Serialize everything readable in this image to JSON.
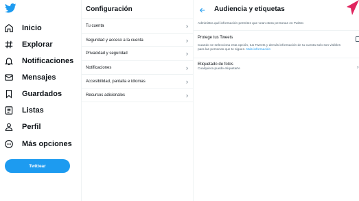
{
  "nav": {
    "items": [
      {
        "label": "Inicio",
        "icon": "home-icon"
      },
      {
        "label": "Explorar",
        "icon": "hashtag-icon"
      },
      {
        "label": "Notificaciones",
        "icon": "bell-icon"
      },
      {
        "label": "Mensajes",
        "icon": "envelope-icon"
      },
      {
        "label": "Guardados",
        "icon": "bookmark-icon"
      },
      {
        "label": "Listas",
        "icon": "list-icon"
      },
      {
        "label": "Perfil",
        "icon": "person-icon"
      },
      {
        "label": "Más opciones",
        "icon": "more-circle-icon"
      }
    ],
    "tweet_button": "Twittear"
  },
  "settings": {
    "title": "Configuración",
    "items": [
      "Tu cuenta",
      "Seguridad y acceso a la cuenta",
      "Privacidad y seguridad",
      "Notificaciones",
      "Accesibilidad, pantalla e idiomas",
      "Recursos adicionales"
    ]
  },
  "detail": {
    "title": "Audiencia y etiquetas",
    "description": "Administra qué información permites que vean otras personas en Twitter.",
    "protect": {
      "title": "Protege tus Tweets",
      "text_line1": "Cuando se selecciona esta opción, tus Tweets y demás información de tu cuenta solo son visibles",
      "text_line2": "para las personas que te siguen.",
      "link": "Más información",
      "checked": false
    },
    "tagging": {
      "title": "Etiquetado de fotos",
      "subtitle": "Cualquiera puede etiquetarte"
    }
  },
  "colors": {
    "accent": "#1d9bf0",
    "text": "#0f1419",
    "secondary": "#536471",
    "divider": "#eff3f4",
    "cursor": "#e0245e"
  }
}
